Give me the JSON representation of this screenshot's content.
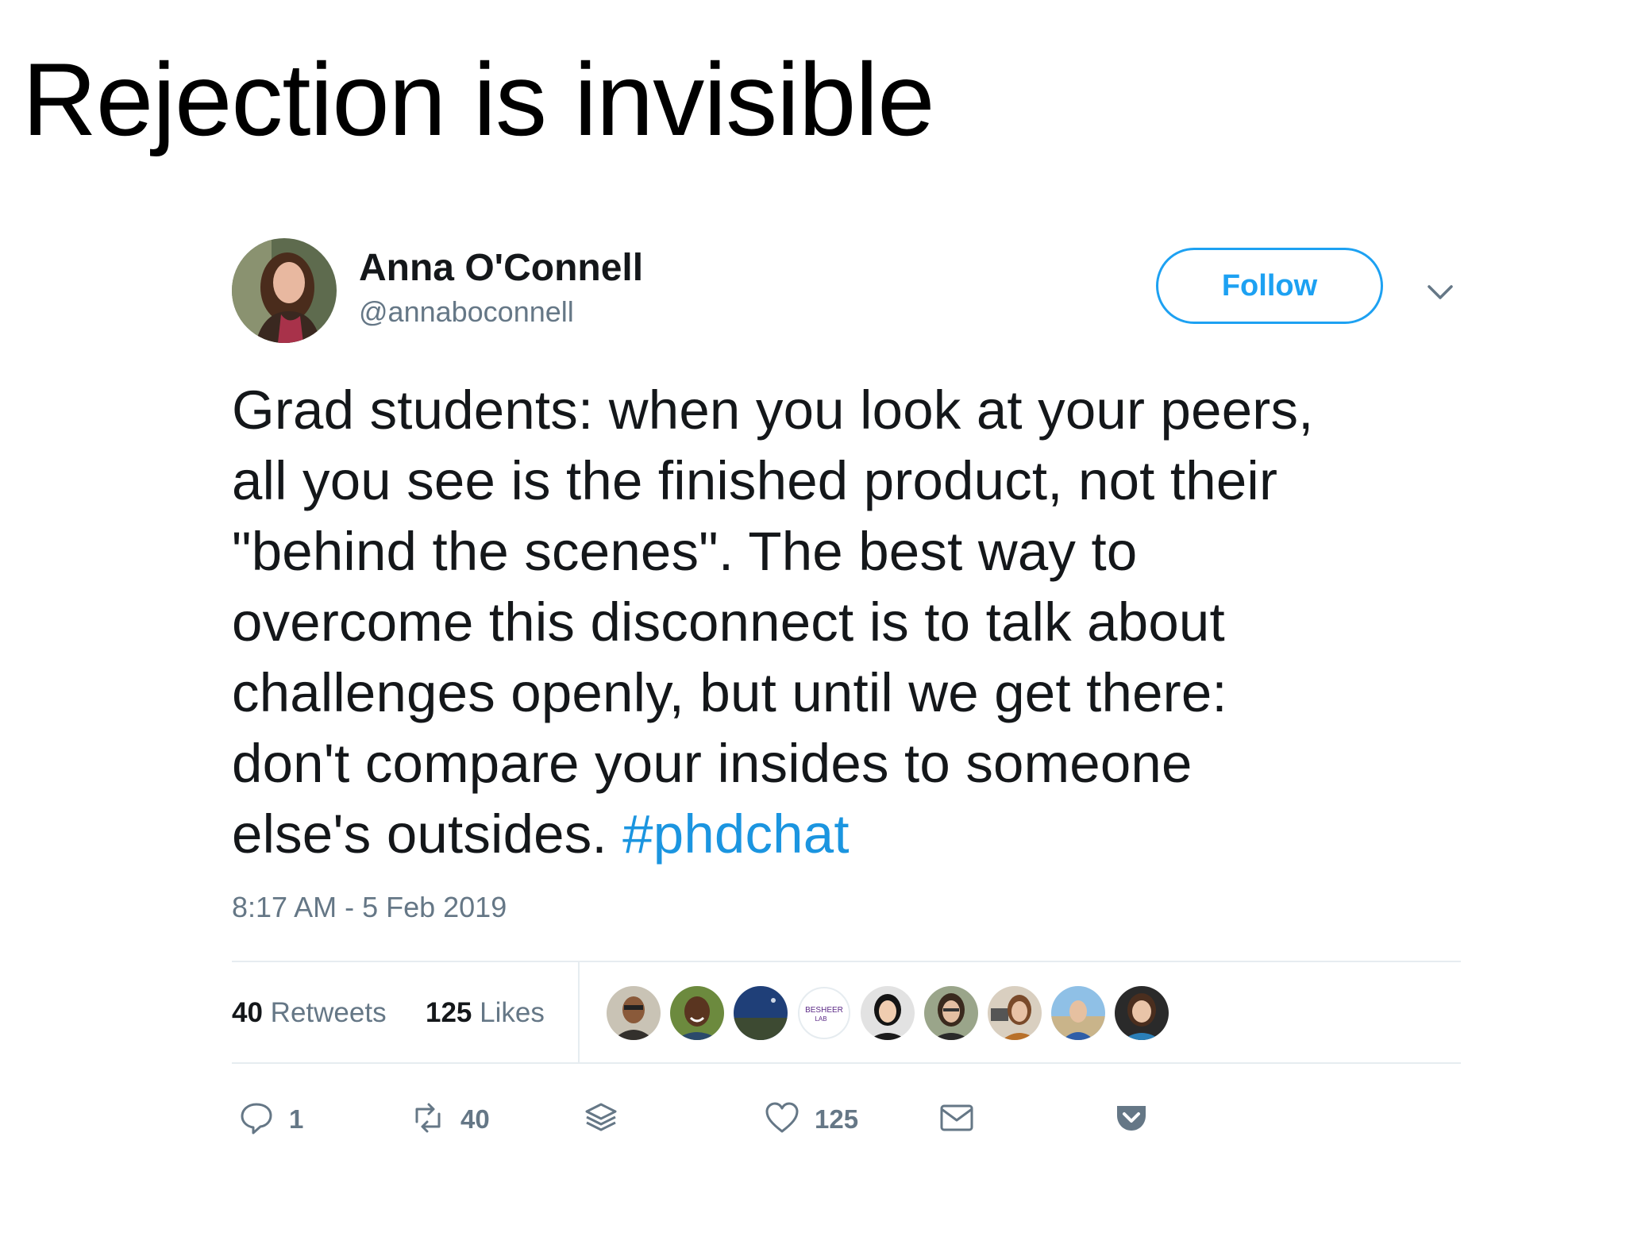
{
  "slide": {
    "title": "Rejection is invisible"
  },
  "tweet": {
    "author": {
      "name": "Anna O'Connell",
      "handle": "@annaboconnell"
    },
    "follow_label": "Follow",
    "text_lines": [
      "Grad students: when you look at your peers,",
      "all you see is the finished product, not their",
      "\"behind the scenes\". The best way to",
      "overcome this disconnect is to talk about",
      "challenges openly, but until we get there:",
      "don't compare your insides to someone",
      "else's outsides. "
    ],
    "hashtag": "#phdchat",
    "timestamp": "8:17 AM - 5 Feb 2019",
    "stats": {
      "retweets_count": "40",
      "retweets_label": "Retweets",
      "likes_count": "125",
      "likes_label": "Likes"
    },
    "likers_badge_text": "BESHEER LAB",
    "actions": {
      "reply_count": "1",
      "retweet_count": "40",
      "like_count": "125"
    },
    "colors": {
      "accent": "#1da1f2",
      "hashtag": "#1b95e0",
      "muted": "#657786",
      "text": "#14171a"
    }
  }
}
